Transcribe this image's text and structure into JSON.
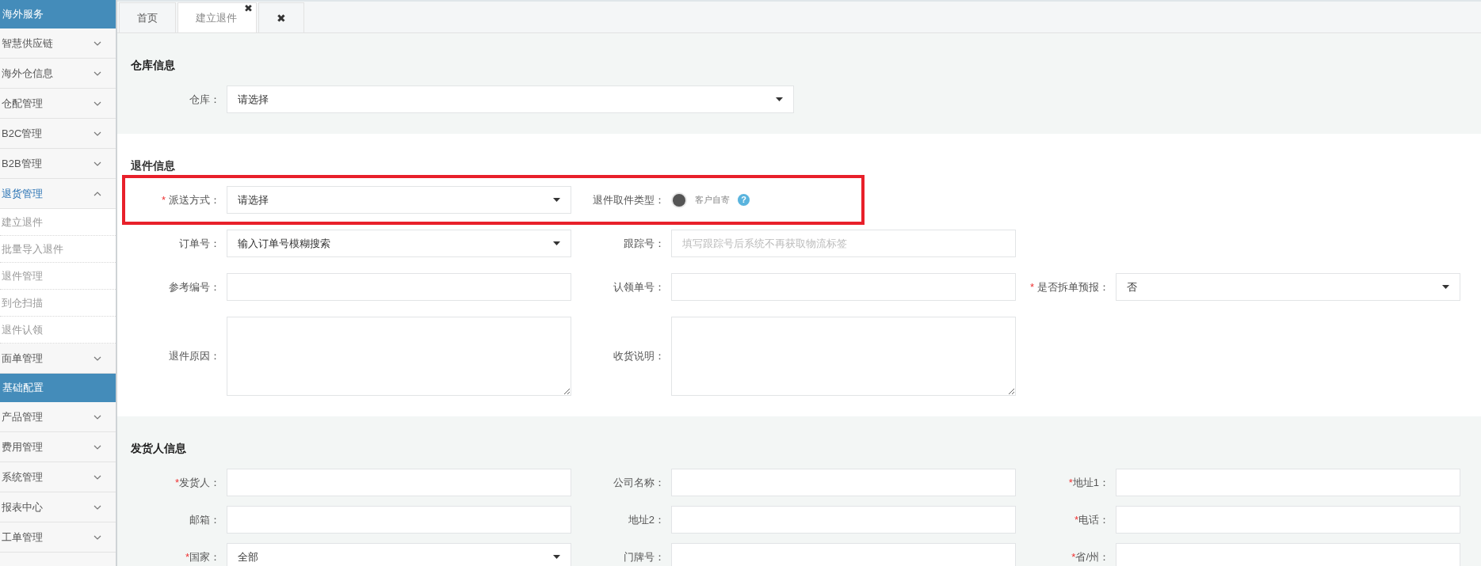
{
  "sidebar": {
    "groups": [
      {
        "title": "海外服务",
        "items": [
          {
            "label": "智慧供应链",
            "expanded": false
          },
          {
            "label": "海外仓信息",
            "expanded": false
          },
          {
            "label": "仓配管理",
            "expanded": false
          },
          {
            "label": "B2C管理",
            "expanded": false
          },
          {
            "label": "B2B管理",
            "expanded": false
          },
          {
            "label": "退货管理",
            "expanded": true,
            "children": [
              {
                "label": "建立退件"
              },
              {
                "label": "批量导入退件"
              },
              {
                "label": "退件管理"
              },
              {
                "label": "到仓扫描"
              },
              {
                "label": "退件认领"
              }
            ]
          },
          {
            "label": "面单管理",
            "expanded": false
          }
        ]
      },
      {
        "title": "基础配置",
        "items": [
          {
            "label": "产品管理",
            "expanded": false
          },
          {
            "label": "费用管理",
            "expanded": false
          },
          {
            "label": "系统管理",
            "expanded": false
          },
          {
            "label": "报表中心",
            "expanded": false
          },
          {
            "label": "工单管理",
            "expanded": false
          }
        ]
      }
    ]
  },
  "tabs": [
    {
      "label": "首页",
      "selected": false
    },
    {
      "label": "建立退件",
      "selected": true,
      "close": "✖"
    },
    {
      "label": "✖",
      "selected": false
    }
  ],
  "sections": [
    {
      "title": "仓库信息",
      "rows": [
        {
          "highlighted": false,
          "fields": [
            {
              "label": "仓库：",
              "kind": "select",
              "value": "请选择"
            }
          ]
        }
      ]
    },
    {
      "title": "退件信息",
      "rows": [
        {
          "highlighted": true,
          "fields": [
            {
              "label": "派送方式：",
              "required_mark": "*",
              "kind": "select",
              "value": "请选择"
            },
            {
              "label": "退件取件类型：",
              "kind": "radio",
              "options": [
                {
                  "label": "客户自寄",
                  "selected": true
                }
              ],
              "help": "?"
            }
          ]
        },
        {
          "highlighted": false,
          "fields": [
            {
              "label": "订单号：",
              "kind": "select",
              "value": "输入订单号模糊搜索"
            },
            {
              "label": "跟踪号：",
              "kind": "input",
              "placeholder": "填写跟踪号后系统不再获取物流标签"
            }
          ]
        },
        {
          "highlighted": false,
          "fields": [
            {
              "label": "参考编号：",
              "kind": "input"
            },
            {
              "label": "认领单号：",
              "kind": "input"
            },
            {
              "label": "是否拆单预报：",
              "required_mark": "*",
              "kind": "select",
              "value": "否"
            }
          ]
        },
        {
          "highlighted": false,
          "fields": [
            {
              "label": "退件原因：",
              "kind": "textarea"
            },
            {
              "label": "收货说明：",
              "kind": "textarea"
            }
          ]
        }
      ]
    },
    {
      "title": "发货人信息",
      "rows": [
        {
          "highlighted": false,
          "fields": [
            {
              "label": "发货人：",
              "required_mark": "*",
              "kind": "input"
            },
            {
              "label": "公司名称：",
              "kind": "input"
            },
            {
              "label": "地址1：",
              "required_mark": "*",
              "kind": "input"
            }
          ]
        },
        {
          "highlighted": false,
          "fields": [
            {
              "label": "邮箱：",
              "kind": "input"
            },
            {
              "label": "地址2：",
              "kind": "input"
            },
            {
              "label": "电话：",
              "required_mark": "*",
              "kind": "input"
            }
          ]
        },
        {
          "highlighted": false,
          "fields": [
            {
              "label": "国家：",
              "required_mark": "*",
              "kind": "select",
              "value": "全部"
            },
            {
              "label": "门牌号：",
              "kind": "input"
            },
            {
              "label": "省/州：",
              "required_mark": "*",
              "kind": "input"
            }
          ]
        }
      ]
    }
  ]
}
